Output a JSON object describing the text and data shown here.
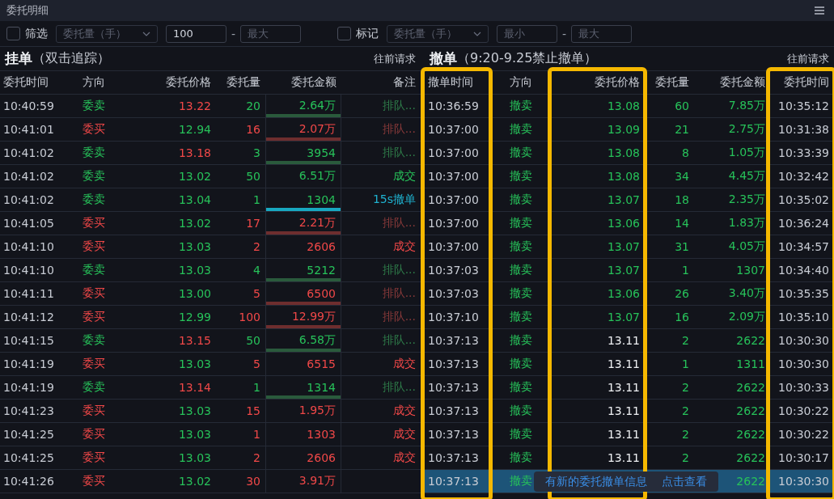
{
  "window": {
    "title": "委托明细"
  },
  "filters": [
    {
      "label": "筛选",
      "checked": false,
      "select": "委托量（手）",
      "min": {
        "value": "100"
      },
      "max": {
        "placeholder": "最大"
      },
      "separator": "-"
    },
    {
      "label": "标记",
      "checked": false,
      "select": "委托量（手）",
      "min": {
        "placeholder": "最小"
      },
      "max": {
        "placeholder": "最大"
      },
      "separator": "-"
    }
  ],
  "orders": {
    "title": "挂单",
    "subtitle": "（双击追踪）",
    "action": "往前请求",
    "columns": [
      "委托时间",
      "方向",
      "委托价格",
      "委托量",
      "委托金额",
      "备注"
    ],
    "rows": [
      {
        "time": "10:40:59",
        "kind": "sell",
        "direction": "委卖",
        "price": {
          "value": "13.22",
          "color": "#f04848"
        },
        "qty": "20",
        "amount": "2.64万",
        "bar": {
          "color": "#2a5a3c"
        },
        "note": {
          "text": "排队...",
          "color": "#2f7d4a"
        }
      },
      {
        "time": "10:41:01",
        "kind": "buy",
        "direction": "委买",
        "price": {
          "value": "12.94",
          "color": "#27c25a"
        },
        "qty": "16",
        "amount": "2.07万",
        "bar": {
          "color": "#6e2e2e"
        },
        "note": {
          "text": "排队...",
          "color": "#8a3a3a"
        }
      },
      {
        "time": "10:41:02",
        "kind": "sell",
        "direction": "委卖",
        "price": {
          "value": "13.18",
          "color": "#f04848"
        },
        "qty": "3",
        "amount": "3954",
        "bar": {
          "color": "#2a5a3c"
        },
        "note": {
          "text": "排队...",
          "color": "#2f7d4a"
        }
      },
      {
        "time": "10:41:02",
        "kind": "sell",
        "direction": "委卖",
        "price": {
          "value": "13.02",
          "color": "#27c25a"
        },
        "qty": "50",
        "amount": "6.51万",
        "note": {
          "text": "成交",
          "color": "#27c25a"
        }
      },
      {
        "time": "10:41:02",
        "kind": "sell",
        "direction": "委卖",
        "price": {
          "value": "13.04",
          "color": "#27c25a"
        },
        "qty": "1",
        "amount": "1304",
        "bar": {
          "color": "#18a8c0"
        },
        "note": {
          "text": "15s撤单",
          "color": "#1fb2d0"
        }
      },
      {
        "time": "10:41:05",
        "kind": "buy",
        "direction": "委买",
        "price": {
          "value": "13.02",
          "color": "#27c25a"
        },
        "qty": "17",
        "amount": "2.21万",
        "bar": {
          "color": "#6e2e2e"
        },
        "note": {
          "text": "排队...",
          "color": "#8a3a3a"
        }
      },
      {
        "time": "10:41:10",
        "kind": "buy",
        "direction": "委买",
        "price": {
          "value": "13.03",
          "color": "#27c25a"
        },
        "qty": "2",
        "amount": "2606",
        "note": {
          "text": "成交",
          "color": "#f04848"
        }
      },
      {
        "time": "10:41:10",
        "kind": "sell",
        "direction": "委卖",
        "price": {
          "value": "13.03",
          "color": "#27c25a"
        },
        "qty": "4",
        "amount": "5212",
        "bar": {
          "color": "#2a5a3c"
        },
        "note": {
          "text": "排队...",
          "color": "#2f7d4a"
        }
      },
      {
        "time": "10:41:11",
        "kind": "buy",
        "direction": "委买",
        "price": {
          "value": "13.00",
          "color": "#27c25a"
        },
        "qty": "5",
        "amount": "6500",
        "bar": {
          "color": "#6e2e2e"
        },
        "note": {
          "text": "排队...",
          "color": "#8a3a3a"
        }
      },
      {
        "time": "10:41:12",
        "kind": "buy",
        "direction": "委买",
        "price": {
          "value": "12.99",
          "color": "#27c25a"
        },
        "qty": "100",
        "amount": "12.99万",
        "bar": {
          "color": "#6e2e2e"
        },
        "note": {
          "text": "排队...",
          "color": "#8a3a3a"
        }
      },
      {
        "time": "10:41:15",
        "kind": "sell",
        "direction": "委卖",
        "price": {
          "value": "13.15",
          "color": "#f04848"
        },
        "qty": "50",
        "amount": "6.58万",
        "bar": {
          "color": "#2a5a3c"
        },
        "note": {
          "text": "排队...",
          "color": "#2f7d4a"
        }
      },
      {
        "time": "10:41:19",
        "kind": "buy",
        "direction": "委买",
        "price": {
          "value": "13.03",
          "color": "#27c25a"
        },
        "qty": "5",
        "amount": "6515",
        "note": {
          "text": "成交",
          "color": "#f04848"
        }
      },
      {
        "time": "10:41:19",
        "kind": "sell",
        "direction": "委卖",
        "price": {
          "value": "13.14",
          "color": "#f04848"
        },
        "qty": "1",
        "amount": "1314",
        "bar": {
          "color": "#2a5a3c"
        },
        "note": {
          "text": "排队...",
          "color": "#2f7d4a"
        }
      },
      {
        "time": "10:41:23",
        "kind": "buy",
        "direction": "委买",
        "price": {
          "value": "13.03",
          "color": "#27c25a"
        },
        "qty": "15",
        "amount": "1.95万",
        "note": {
          "text": "成交",
          "color": "#f04848"
        }
      },
      {
        "time": "10:41:25",
        "kind": "buy",
        "direction": "委买",
        "price": {
          "value": "13.03",
          "color": "#27c25a"
        },
        "qty": "1",
        "amount": "1303",
        "note": {
          "text": "成交",
          "color": "#f04848"
        }
      },
      {
        "time": "10:41:25",
        "kind": "buy",
        "direction": "委买",
        "price": {
          "value": "13.03",
          "color": "#27c25a"
        },
        "qty": "2",
        "amount": "2606",
        "note": {
          "text": "成交",
          "color": "#f04848"
        }
      },
      {
        "time": "10:41:26",
        "kind": "buy",
        "direction": "委买",
        "price": {
          "value": "13.02",
          "color": "#27c25a"
        },
        "qty": "30",
        "amount": "3.91万"
      }
    ]
  },
  "cancels": {
    "title": "撤单",
    "subtitle": "（9:20-9.25禁止撤单）",
    "action": "往前请求",
    "columns": [
      {
        "label": "撤单时间",
        "highlighted": true
      },
      {
        "label": "方向",
        "highlighted": false
      },
      {
        "label": "委托价格",
        "highlighted": true
      },
      {
        "label": "委托量",
        "highlighted": false
      },
      {
        "label": "委托金额",
        "highlighted": false
      },
      {
        "label": "委托时间",
        "highlighted": true
      }
    ],
    "rows": [
      {
        "time": "10:36:59",
        "kind": "sell",
        "direction": "撤卖",
        "price": {
          "value": "13.08",
          "color": "#27c25a"
        },
        "qty": "60",
        "amount": "7.85万",
        "order_time": "10:35:12",
        "selected": false
      },
      {
        "time": "10:37:00",
        "kind": "sell",
        "direction": "撤卖",
        "price": {
          "value": "13.09",
          "color": "#27c25a"
        },
        "qty": "21",
        "amount": "2.75万",
        "order_time": "10:31:38",
        "selected": false
      },
      {
        "time": "10:37:00",
        "kind": "sell",
        "direction": "撤卖",
        "price": {
          "value": "13.08",
          "color": "#27c25a"
        },
        "qty": "8",
        "amount": "1.05万",
        "order_time": "10:33:39",
        "selected": false
      },
      {
        "time": "10:37:00",
        "kind": "sell",
        "direction": "撤卖",
        "price": {
          "value": "13.08",
          "color": "#27c25a"
        },
        "qty": "34",
        "amount": "4.45万",
        "order_time": "10:32:42",
        "selected": false
      },
      {
        "time": "10:37:00",
        "kind": "sell",
        "direction": "撤卖",
        "price": {
          "value": "13.07",
          "color": "#27c25a"
        },
        "qty": "18",
        "amount": "2.35万",
        "order_time": "10:35:02",
        "selected": false
      },
      {
        "time": "10:37:00",
        "kind": "sell",
        "direction": "撤卖",
        "price": {
          "value": "13.06",
          "color": "#27c25a"
        },
        "qty": "14",
        "amount": "1.83万",
        "order_time": "10:36:24",
        "selected": false
      },
      {
        "time": "10:37:00",
        "kind": "sell",
        "direction": "撤卖",
        "price": {
          "value": "13.07",
          "color": "#27c25a"
        },
        "qty": "31",
        "amount": "4.05万",
        "order_time": "10:34:57",
        "selected": false
      },
      {
        "time": "10:37:03",
        "kind": "sell",
        "direction": "撤卖",
        "price": {
          "value": "13.07",
          "color": "#27c25a"
        },
        "qty": "1",
        "amount": "1307",
        "order_time": "10:34:40",
        "selected": false
      },
      {
        "time": "10:37:03",
        "kind": "sell",
        "direction": "撤卖",
        "price": {
          "value": "13.06",
          "color": "#27c25a"
        },
        "qty": "26",
        "amount": "3.40万",
        "order_time": "10:35:35",
        "selected": false
      },
      {
        "time": "10:37:10",
        "kind": "sell",
        "direction": "撤卖",
        "price": {
          "value": "13.07",
          "color": "#27c25a"
        },
        "qty": "16",
        "amount": "2.09万",
        "order_time": "10:35:10",
        "selected": false
      },
      {
        "time": "10:37:13",
        "kind": "sell",
        "direction": "撤卖",
        "price": {
          "value": "13.11",
          "color": "#eef0f3"
        },
        "qty": "2",
        "amount": "2622",
        "order_time": "10:30:30",
        "selected": false
      },
      {
        "time": "10:37:13",
        "kind": "sell",
        "direction": "撤卖",
        "price": {
          "value": "13.11",
          "color": "#eef0f3"
        },
        "qty": "1",
        "amount": "1311",
        "order_time": "10:30:30",
        "selected": false
      },
      {
        "time": "10:37:13",
        "kind": "sell",
        "direction": "撤卖",
        "price": {
          "value": "13.11",
          "color": "#eef0f3"
        },
        "qty": "2",
        "amount": "2622",
        "order_time": "10:30:33",
        "selected": false
      },
      {
        "time": "10:37:13",
        "kind": "sell",
        "direction": "撤卖",
        "price": {
          "value": "13.11",
          "color": "#eef0f3"
        },
        "qty": "2",
        "amount": "2622",
        "order_time": "10:30:22",
        "selected": false
      },
      {
        "time": "10:37:13",
        "kind": "sell",
        "direction": "撤卖",
        "price": {
          "value": "13.11",
          "color": "#eef0f3"
        },
        "qty": "2",
        "amount": "2622",
        "order_time": "10:30:22",
        "selected": false
      },
      {
        "time": "10:37:13",
        "kind": "sell",
        "direction": "撤卖",
        "price": {
          "value": "13.11",
          "color": "#eef0f3"
        },
        "qty": "2",
        "amount": "2622",
        "order_time": "10:30:17",
        "selected": false
      },
      {
        "time": "10:37:13",
        "kind": "sell",
        "direction": "撤卖",
        "amount": "2622",
        "order_time": "10:30:30",
        "selected": true
      }
    ],
    "toast": {
      "message": "有新的委托撤单信息",
      "link": "点击查看"
    }
  }
}
